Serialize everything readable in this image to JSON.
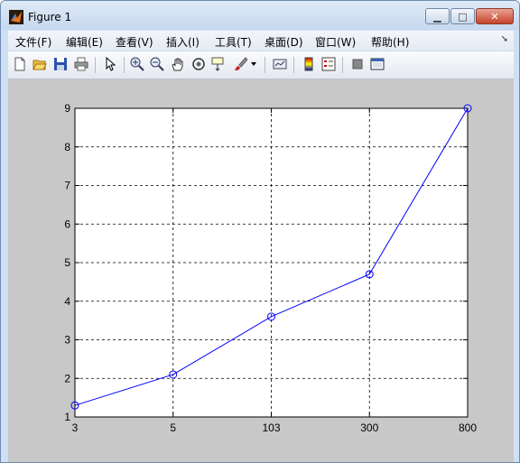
{
  "window": {
    "title": "Figure 1"
  },
  "menu": [
    {
      "label": "文件(F)",
      "name": "menu-file"
    },
    {
      "label": "编辑(E)",
      "name": "menu-edit"
    },
    {
      "label": "查看(V)",
      "name": "menu-view"
    },
    {
      "label": "插入(I)",
      "name": "menu-insert"
    },
    {
      "label": "工具(T)",
      "name": "menu-tools"
    },
    {
      "label": "桌面(D)",
      "name": "menu-desktop"
    },
    {
      "label": "窗口(W)",
      "name": "menu-window"
    },
    {
      "label": "帮助(H)",
      "name": "menu-help"
    }
  ],
  "toolbar": [
    "new-figure-icon",
    "open-file-icon",
    "save-icon",
    "print-icon",
    "edit-plot-arrow-icon",
    "zoom-in-icon",
    "zoom-out-icon",
    "pan-hand-icon",
    "rotate-3d-icon",
    "data-cursor-icon",
    "brush-icon",
    "link-plot-icon",
    "colorbar-icon",
    "legend-icon",
    "hide-plot-tools-icon",
    "show-plot-tools-icon"
  ],
  "colors": {
    "line": "#0000ff",
    "grid": "#000000",
    "background": "#c8c8c8"
  },
  "chart_data": {
    "type": "line",
    "x": [
      "3",
      "5",
      "103",
      "300",
      "800"
    ],
    "y": [
      1.3,
      2.1,
      3.6,
      4.7,
      9.0
    ],
    "ylim": [
      1,
      9
    ],
    "yticks": [
      1,
      2,
      3,
      4,
      5,
      6,
      7,
      8,
      9
    ],
    "marker": "circle",
    "grid": true,
    "title": "",
    "xlabel": "",
    "ylabel": ""
  }
}
